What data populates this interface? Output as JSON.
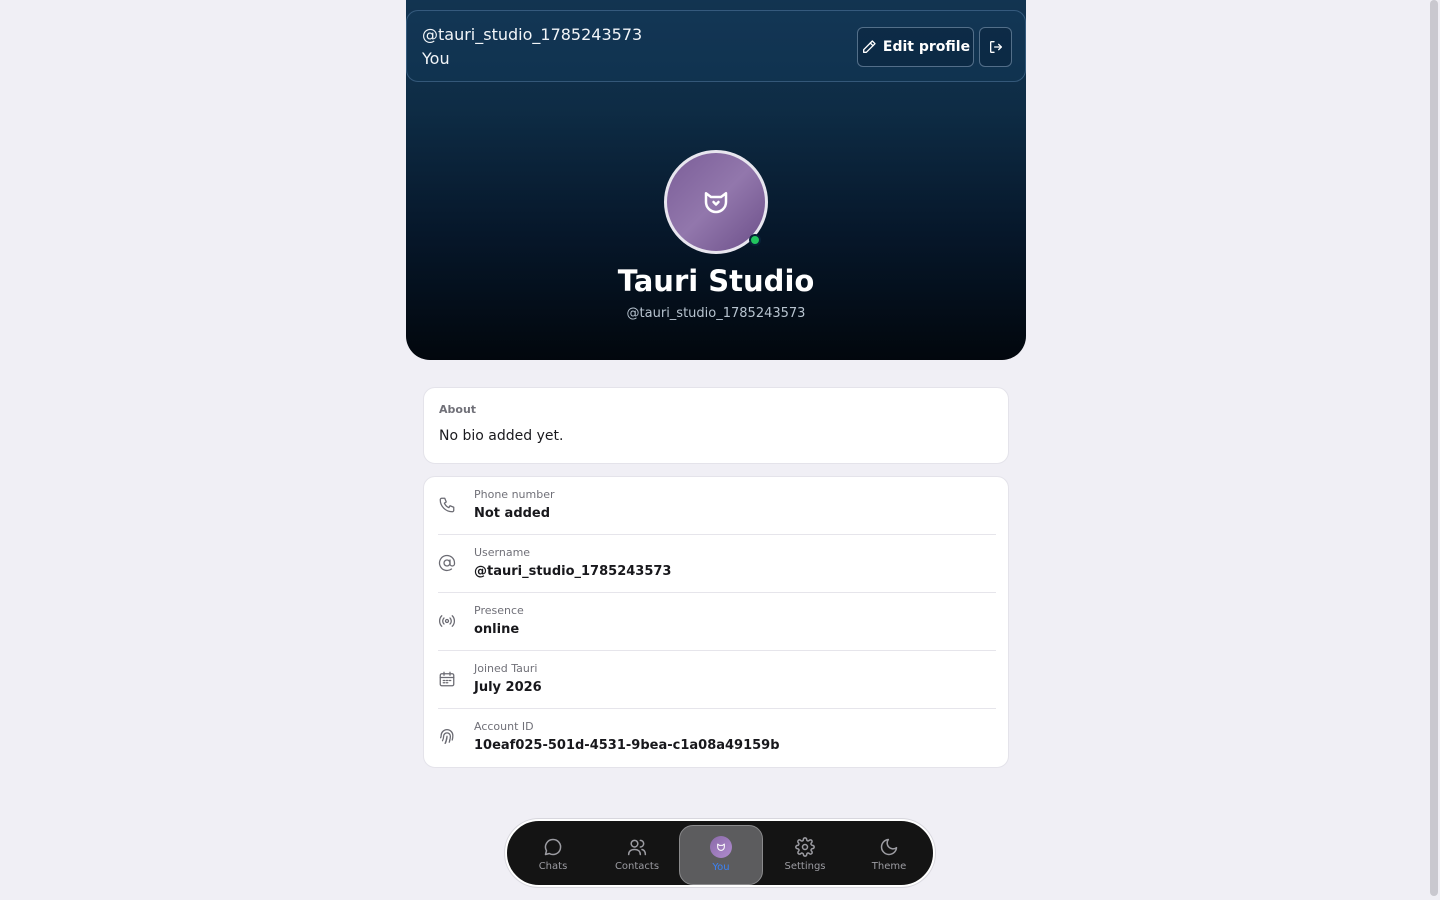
{
  "header": {
    "handle": "@tauri_studio_1785243573",
    "subtitle": "You",
    "edit_label": "Edit profile",
    "edit_icon": "pencil-icon",
    "logout_icon": "logout-icon"
  },
  "profile": {
    "name": "Tauri Studio",
    "handle": "@tauri_studio_1785243573",
    "avatar_icon": "owl-logo-icon",
    "status_color": "#22c55e"
  },
  "about": {
    "label": "About",
    "text": "No bio added yet."
  },
  "info": [
    {
      "icon": "phone-icon",
      "label": "Phone number",
      "value": "Not added"
    },
    {
      "icon": "at-sign-icon",
      "label": "Username",
      "value": "@tauri_studio_1785243573"
    },
    {
      "icon": "radio-icon",
      "label": "Presence",
      "value": "online"
    },
    {
      "icon": "calendar-icon",
      "label": "Joined Tauri",
      "value": "July 2026"
    },
    {
      "icon": "fingerprint-icon",
      "label": "Account ID",
      "value": "10eaf025-501d-4531-9bea-c1a08a49159b"
    }
  ],
  "nav": {
    "items": [
      {
        "icon": "chat-bubble-icon",
        "label": "Chats",
        "active": false
      },
      {
        "icon": "contacts-icon",
        "label": "Contacts",
        "active": false
      },
      {
        "icon": "profile-avatar-icon",
        "label": "You",
        "active": true
      },
      {
        "icon": "gear-icon",
        "label": "Settings",
        "active": false
      },
      {
        "icon": "moon-icon",
        "label": "Theme",
        "active": false
      }
    ],
    "active_color": "#3b82f6"
  }
}
